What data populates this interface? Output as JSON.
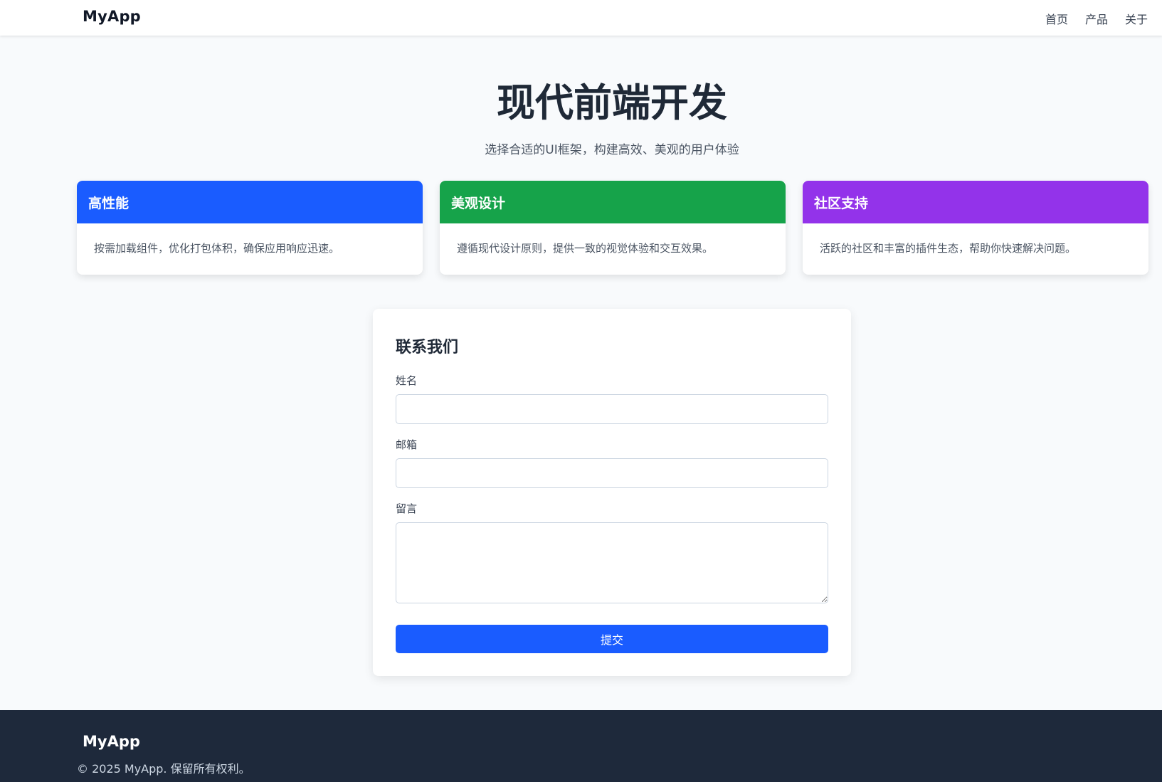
{
  "navbar": {
    "brand": "MyApp",
    "links": [
      "首页",
      "产品",
      "关于"
    ]
  },
  "hero": {
    "title": "现代前端开发",
    "subtitle": "选择合适的UI框架，构建高效、美观的用户体验"
  },
  "cards": [
    {
      "title": "高性能",
      "body": "按需加载组件，优化打包体积，确保应用响应迅速。",
      "color": "#1a5cff"
    },
    {
      "title": "美观设计",
      "body": "遵循现代设计原则，提供一致的视觉体验和交互效果。",
      "color": "#16a34a"
    },
    {
      "title": "社区支持",
      "body": "活跃的社区和丰富的插件生态，帮助你快速解决问题。",
      "color": "#9333ea"
    }
  ],
  "contact_form": {
    "title": "联系我们",
    "name_label": "姓名",
    "name_value": "",
    "email_label": "邮箱",
    "email_value": "",
    "message_label": "留言",
    "message_value": "",
    "submit_label": "提交"
  },
  "footer": {
    "brand": "MyApp",
    "copyright": "© 2025 MyApp. 保留所有权利。"
  }
}
